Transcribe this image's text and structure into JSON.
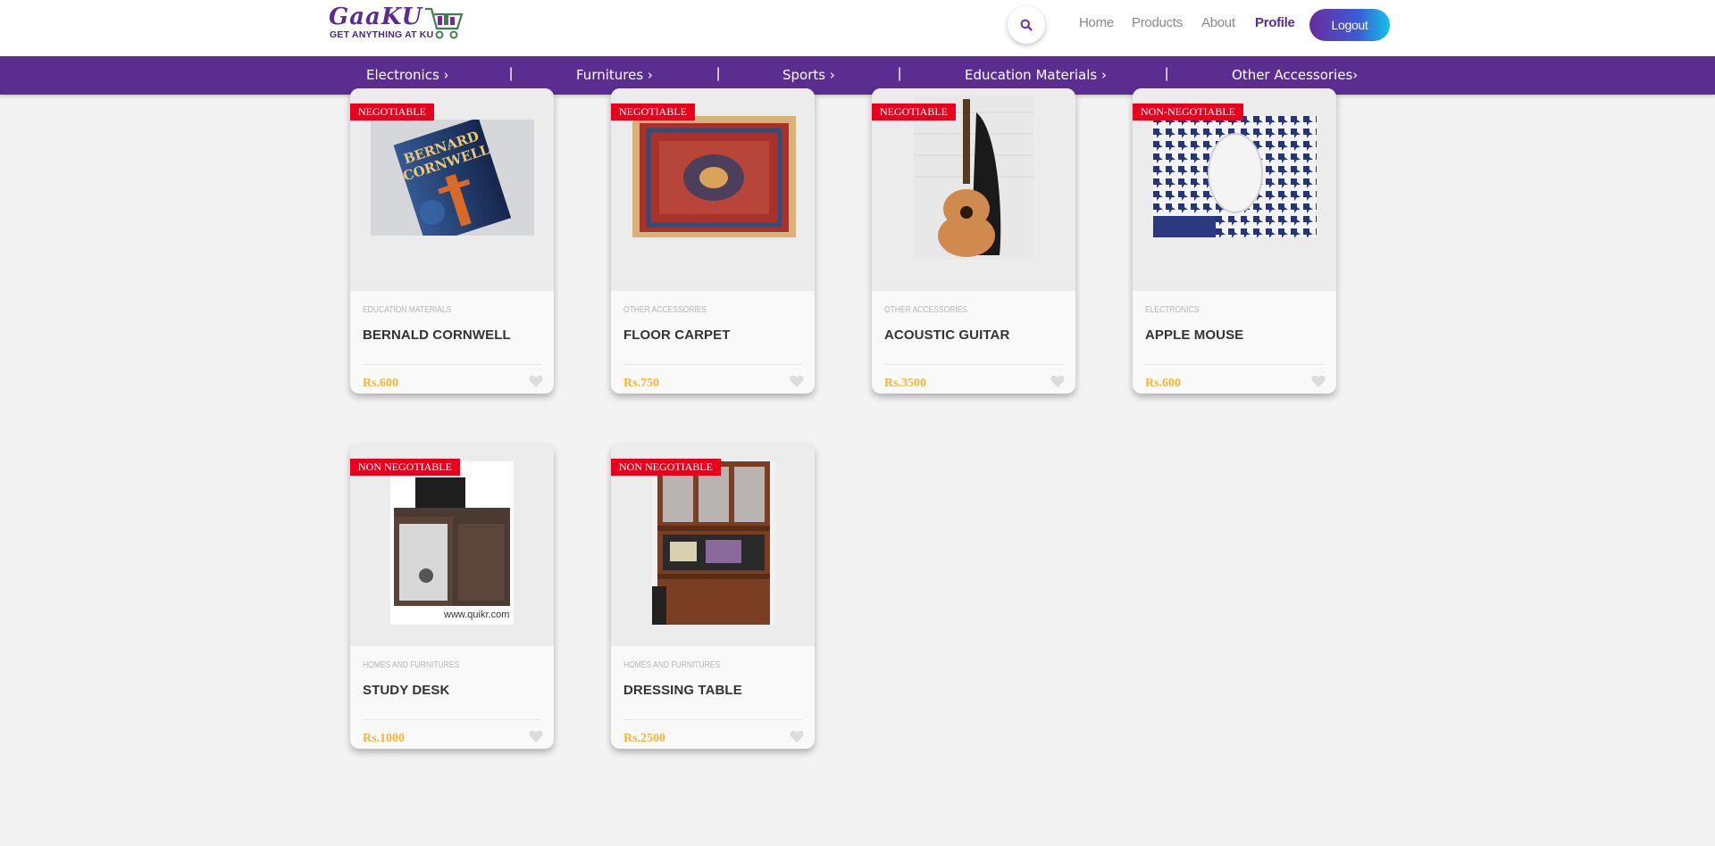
{
  "brand": {
    "name": "GaaKU",
    "tagline": "GET ANYTHING AT KU"
  },
  "nav": {
    "items": [
      {
        "label": "Home"
      },
      {
        "label": "Products"
      },
      {
        "label": "About"
      },
      {
        "label": "Profile"
      }
    ],
    "logout_label": "Logout"
  },
  "categories": [
    {
      "label": "Electronics ›"
    },
    {
      "label": "Furnitures ›"
    },
    {
      "label": "Sports ›"
    },
    {
      "label": "Education Materials ›"
    },
    {
      "label": "Other Accessories›"
    }
  ],
  "category_separator": "|",
  "products": [
    {
      "badge": "NEGOTIABLE",
      "category": "EDUCATION MATERIALS",
      "title": "BERNALD CORNWELL",
      "price": "Rs.600",
      "image": "book-photo"
    },
    {
      "badge": "NEGOTIABLE",
      "category": "OTHER ACCESSORIES",
      "title": "FLOOR CARPET",
      "price": "Rs.750",
      "image": "carpet-photo"
    },
    {
      "badge": "NEGOTIABLE",
      "category": "OTHER ACCESSORIES",
      "title": "ACOUSTIC GUITAR",
      "price": "Rs.3500",
      "image": "guitar-photo"
    },
    {
      "badge": "NON-NEGOTIABLE",
      "category": "ELECTRONICS",
      "title": "APPLE MOUSE",
      "price": "Rs.600",
      "image": "mouse-photo"
    },
    {
      "badge": "NON NEGOTIABLE",
      "category": "HOMES AND FURNITURES",
      "title": "STUDY DESK",
      "price": "Rs.1000",
      "image": "desk-photo",
      "image_caption": "www.quikr.com"
    },
    {
      "badge": "NON NEGOTIABLE",
      "category": "HOMES AND FURNITURES",
      "title": "DRESSING TABLE",
      "price": "Rs.2500",
      "image": "cabinet-photo"
    }
  ],
  "colors": {
    "brand_purple": "#5c2d91",
    "badge_red": "#e8001c",
    "price_gold": "#f2b53a",
    "page_bg": "#f3f3f3"
  }
}
